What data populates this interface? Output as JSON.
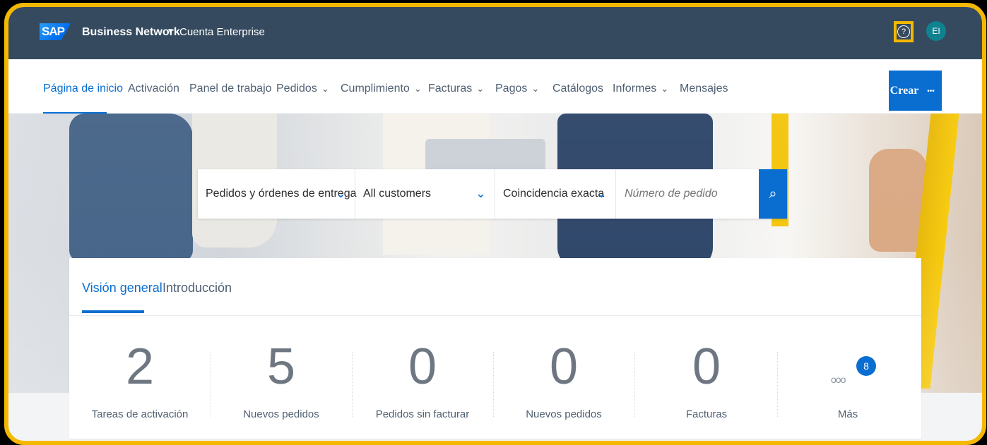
{
  "shell": {
    "brand": "Business Network",
    "brand_caret": "▼",
    "account": "Cuenta Enterprise",
    "help_icon": "?",
    "avatar": "EI"
  },
  "nav": {
    "items": [
      {
        "label": "Página de inicio"
      },
      {
        "label": "Activación"
      },
      {
        "label": "Panel de trabajo"
      },
      {
        "label": "Pedidos"
      },
      {
        "label": "Cumplimiento"
      },
      {
        "label": "Facturas"
      },
      {
        "label": "Pagos"
      },
      {
        "label": "Catálogos"
      },
      {
        "label": "Informes"
      },
      {
        "label": "Mensajes"
      }
    ],
    "create": "Crear",
    "more": "•••"
  },
  "search": {
    "document_type": "Pedidos y órdenes de entrega",
    "customer_scope": "All customers",
    "match_type": "Coincidencia exacta",
    "placeholder": "Número de pedido"
  },
  "overview": {
    "tabs": [
      "Visión general",
      "Introducción"
    ],
    "tiles": [
      {
        "value": "2",
        "label": "Tareas de activación"
      },
      {
        "value": "5",
        "label": "Nuevos pedidos"
      },
      {
        "value": "0",
        "label": "Pedidos sin facturar"
      },
      {
        "value": "0",
        "label": "Nuevos pedidos"
      },
      {
        "value": "0",
        "label": "Facturas"
      }
    ],
    "more": {
      "badge": "8",
      "label": "Más",
      "dots": "ooo"
    }
  },
  "colors": {
    "shell": "#354a5f",
    "primary": "#0a6ed1",
    "highlight": "#f5b800"
  }
}
